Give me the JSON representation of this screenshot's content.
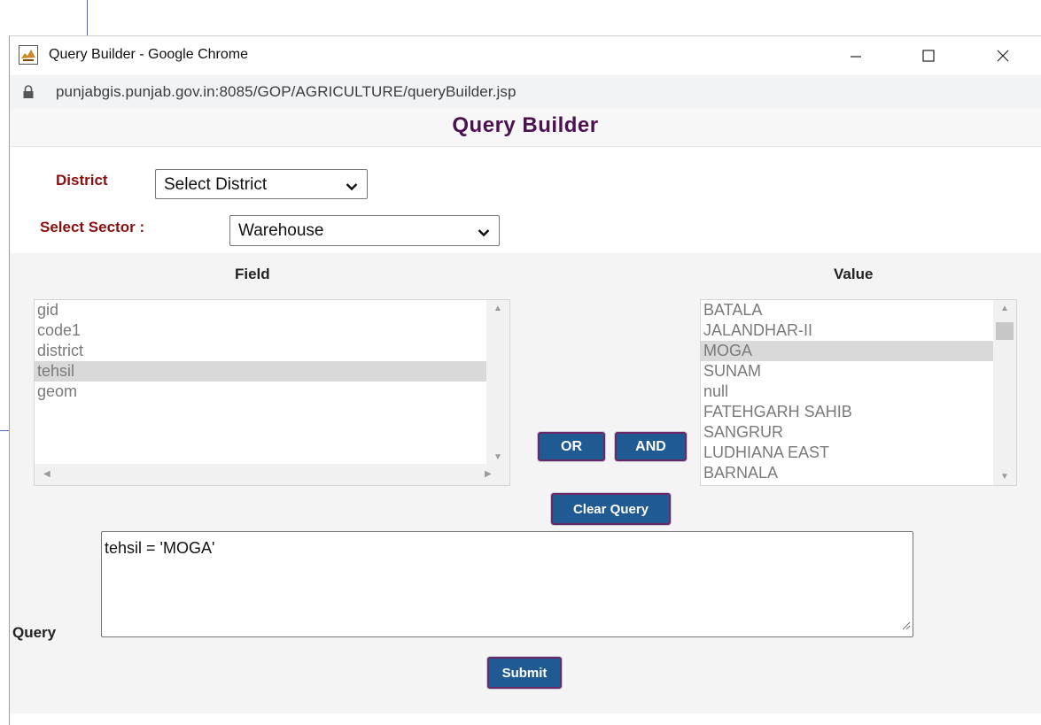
{
  "window": {
    "title": "Query Builder - Google Chrome",
    "url": "punjabgis.punjab.gov.in:8085/GOP/AGRICULTURE/queryBuilder.jsp"
  },
  "page": {
    "title": "Query Builder"
  },
  "filters": {
    "district_label": "District",
    "district_value": "Select District",
    "sector_label": "Select Sector :",
    "sector_value": "Warehouse"
  },
  "field_list": {
    "header": "Field",
    "items": [
      "gid",
      "code1",
      "district",
      "tehsil",
      "geom"
    ],
    "selected": "tehsil"
  },
  "value_list": {
    "header": "Value",
    "items": [
      "BATALA",
      "JALANDHAR-II",
      "MOGA",
      "SUNAM",
      "null",
      "FATEHGARH SAHIB",
      "SANGRUR",
      "LUDHIANA EAST",
      "BARNALA"
    ],
    "selected": "MOGA"
  },
  "buttons": {
    "or": "OR",
    "and": "AND",
    "clear": "Clear Query",
    "submit": "Submit"
  },
  "query": {
    "label": "Query",
    "text": "tehsil = 'MOGA'"
  },
  "colors": {
    "title": "#4b1150",
    "label_red": "#8b0f0f",
    "button_bg": "#205a92",
    "button_border": "#6b2a67"
  }
}
